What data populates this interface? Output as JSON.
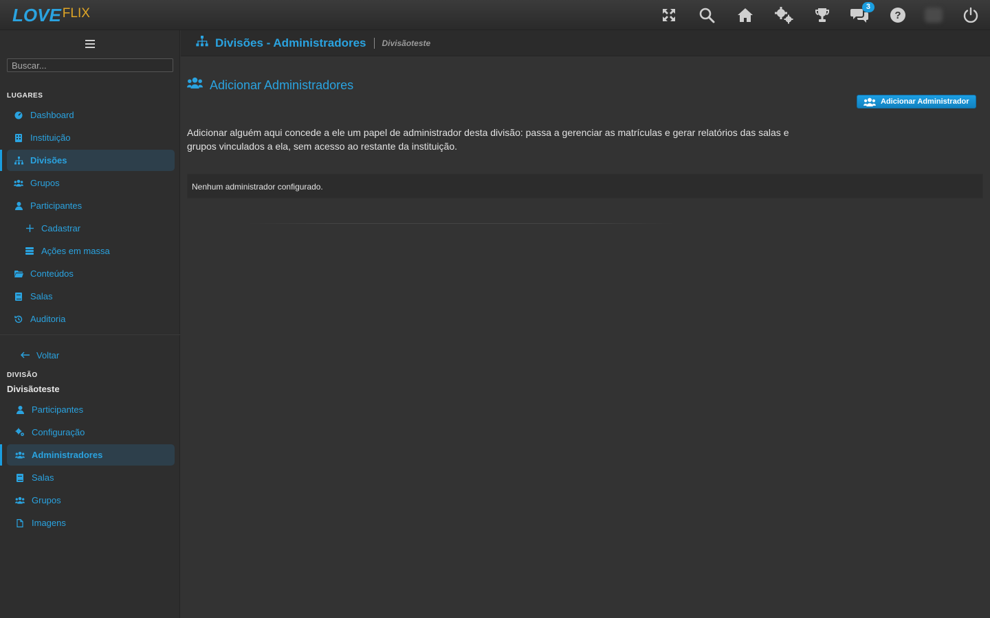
{
  "brand": {
    "part1": "LOVE",
    "part2": "FLIX"
  },
  "topbar": {
    "icons": [
      "fullscreen-icon",
      "search-icon",
      "home-icon",
      "settings-icon",
      "trophy-icon",
      "chat-icon",
      "help-icon",
      "avatar",
      "power-icon"
    ],
    "chat_badge": "3"
  },
  "sidebar": {
    "search_placeholder": "Buscar...",
    "places_label": "LUGARES",
    "items": {
      "dashboard": "Dashboard",
      "instituicao": "Instituição",
      "divisoes": "Divisões",
      "grupos": "Grupos",
      "participantes": "Participantes",
      "cadastrar": "Cadastrar",
      "acoes": "Ações em massa",
      "conteudos": "Conteúdos",
      "salas": "Salas",
      "auditoria": "Auditoria"
    },
    "back": "Voltar",
    "division_label": "DIVISÃO",
    "division_name": "Divisãoteste",
    "division_items": {
      "participantes": "Participantes",
      "configuracao": "Configuração",
      "administradores": "Administradores",
      "salas": "Salas",
      "grupos": "Grupos",
      "imagens": "Imagens"
    }
  },
  "header": {
    "title": "Divisões - Administradores",
    "subtitle": "Divisãoteste"
  },
  "main": {
    "title": "Adicionar Administradores",
    "add_button": "Adicionar Administrador",
    "description": "Adicionar alguém aqui concede a ele um papel de administrador desta divisão: passa a gerenciar as matrículas e gerar relatórios das salas e grupos vinculados a ela, sem acesso ao restante da instituição.",
    "empty_message": "Nenhum administrador configurado."
  },
  "colors": {
    "accent": "#2aa3e0",
    "brand_secondary": "#e0a626",
    "background": "#333333"
  }
}
